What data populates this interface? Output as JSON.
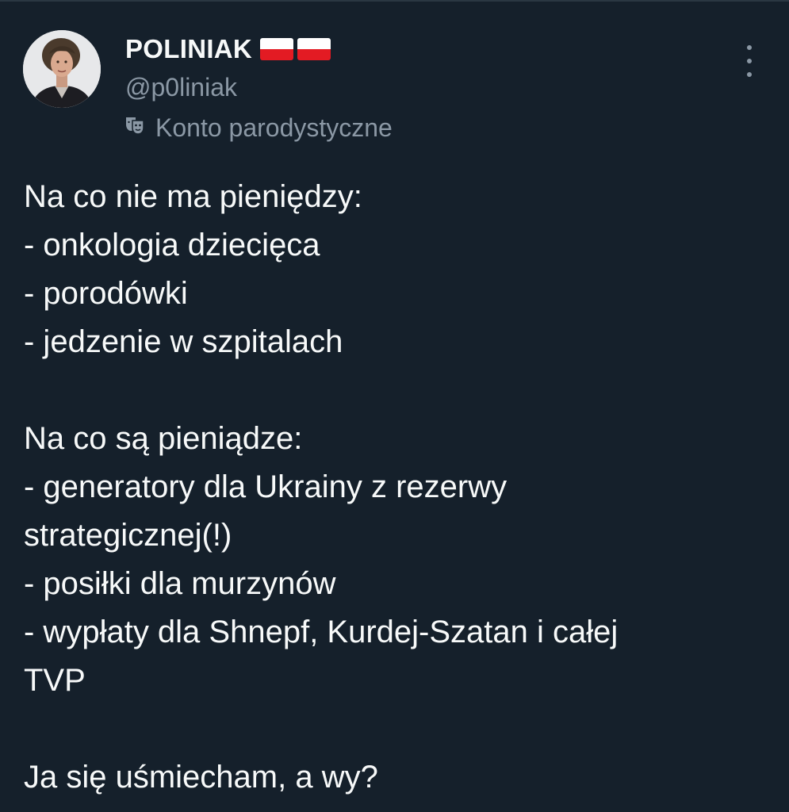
{
  "author": {
    "display_name": "POLINIAK",
    "handle": "@p0liniak",
    "label": "Konto parodystyczne",
    "flags": [
      "poland-flag",
      "poland-flag"
    ]
  },
  "tweet": {
    "lines": [
      "Na co nie ma pieniędzy:",
      "- onkologia dziecięca",
      "- porodówki",
      "- jedzenie w szpitalach",
      "",
      "Na co są pieniądze:",
      "- generatory dla Ukrainy z rezerwy",
      "strategicznej(!)",
      "- posiłki dla murzynów",
      "- wypłaty dla Shnepf, Kurdej-Szatan i całej",
      "TVP",
      "",
      "Ja się uśmiecham, a wy?"
    ]
  },
  "colors": {
    "background": "#15202b",
    "text": "#f7f9f9",
    "secondary_text": "#8b98a5",
    "flag_red": "#e31b23"
  },
  "icons": {
    "parody": "theater-masks-icon",
    "more": "more-options-icon"
  }
}
